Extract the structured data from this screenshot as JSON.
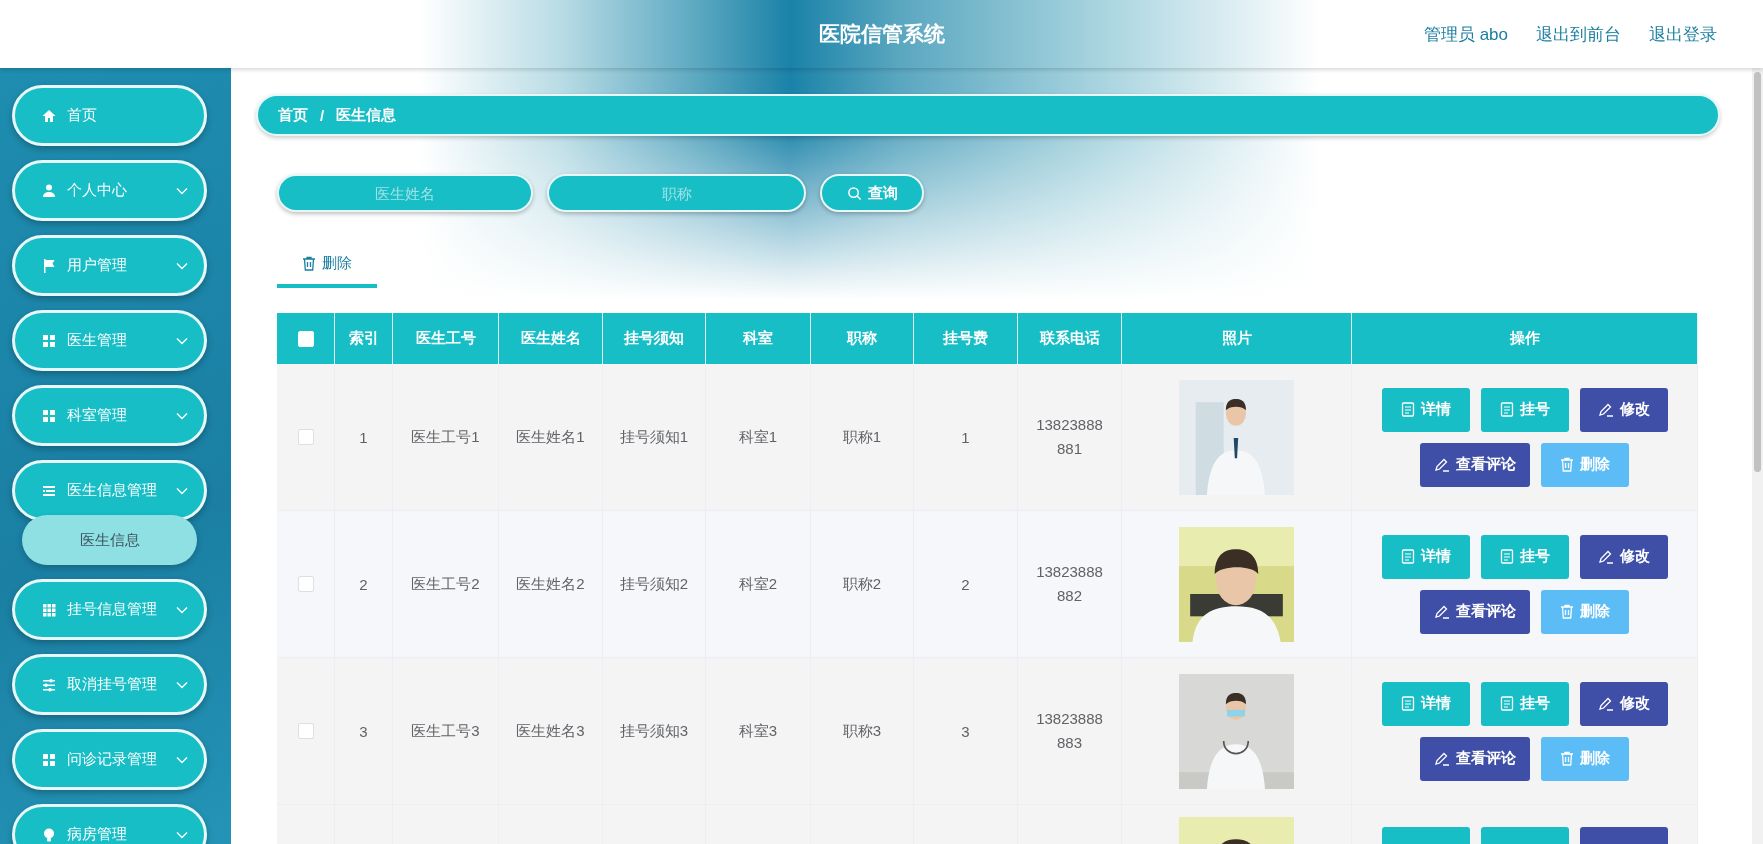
{
  "header": {
    "title": "医院信管系统",
    "links": [
      "管理员 abo",
      "退出到前台",
      "退出登录"
    ]
  },
  "sidebar": {
    "items": [
      {
        "label": "首页",
        "kind": "link"
      },
      {
        "label": "个人中心",
        "kind": "menu"
      },
      {
        "label": "用户管理",
        "kind": "menu"
      },
      {
        "label": "医生管理",
        "kind": "menu"
      },
      {
        "label": "科室管理",
        "kind": "menu"
      },
      {
        "label": "医生信息管理",
        "kind": "menu",
        "children": [
          {
            "label": "医生信息",
            "selected": true
          }
        ]
      },
      {
        "label": "挂号信息管理",
        "kind": "menu"
      },
      {
        "label": "取消挂号管理",
        "kind": "menu"
      },
      {
        "label": "问诊记录管理",
        "kind": "menu"
      },
      {
        "label": "病房管理",
        "kind": "menu"
      }
    ]
  },
  "breadcrumb": {
    "items": [
      "首页",
      "医生信息"
    ],
    "separator": "/"
  },
  "search": {
    "fields": [
      {
        "placeholder": "医生姓名"
      },
      {
        "placeholder": "职称"
      }
    ],
    "button": "查询"
  },
  "toolbar": {
    "tabs": [
      {
        "label": "删除",
        "selected": true
      }
    ]
  },
  "table": {
    "header_checkbox": {
      "checked": false
    },
    "columns": [
      "索引",
      "医生工号",
      "医生姓名",
      "挂号须知",
      "科室",
      "职称",
      "挂号费",
      "联系电话",
      "照片",
      "操作"
    ],
    "rows": [
      {
        "checked": false,
        "cells": [
          "1",
          "医生工号1",
          "医生姓名1",
          "挂号须知1",
          "科室1",
          "职称1",
          "1",
          "13823888881"
        ],
        "actions": [
          {
            "label": "详情",
            "kind": "detail"
          },
          {
            "label": "挂号",
            "kind": "register"
          },
          {
            "label": "修改",
            "kind": "edit"
          },
          {
            "label": "查看评论",
            "kind": "comments"
          },
          {
            "label": "删除",
            "kind": "delete"
          }
        ]
      },
      {
        "checked": false,
        "cells": [
          "2",
          "医生工号2",
          "医生姓名2",
          "挂号须知2",
          "科室2",
          "职称2",
          "2",
          "13823888882"
        ],
        "actions": [
          {
            "label": "详情",
            "kind": "detail"
          },
          {
            "label": "挂号",
            "kind": "register"
          },
          {
            "label": "修改",
            "kind": "edit"
          },
          {
            "label": "查看评论",
            "kind": "comments"
          },
          {
            "label": "删除",
            "kind": "delete"
          }
        ]
      },
      {
        "checked": false,
        "cells": [
          "3",
          "医生工号3",
          "医生姓名3",
          "挂号须知3",
          "科室3",
          "职称3",
          "3",
          "13823888883"
        ],
        "actions": [
          {
            "label": "详情",
            "kind": "detail"
          },
          {
            "label": "挂号",
            "kind": "register"
          },
          {
            "label": "修改",
            "kind": "edit"
          },
          {
            "label": "查看评论",
            "kind": "comments"
          },
          {
            "label": "删除",
            "kind": "delete"
          }
        ]
      }
    ],
    "partial_row": {
      "actions": [
        {
          "color": "#17bec6"
        },
        {
          "color": "#17bec6"
        },
        {
          "color": "#3f4fa8"
        }
      ]
    }
  }
}
